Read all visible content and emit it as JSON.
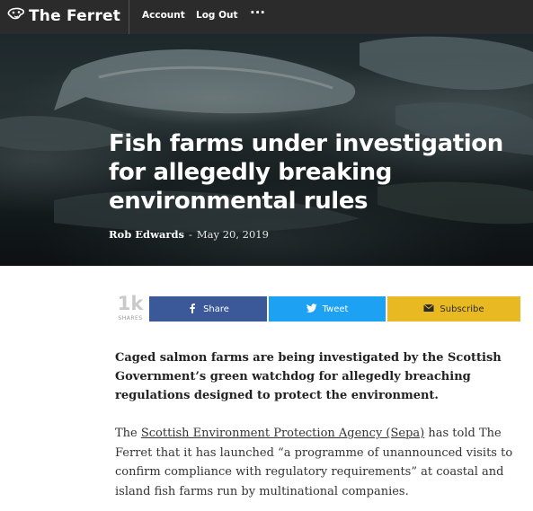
{
  "nav": {
    "logo_text": "The Ferret",
    "account_label": "Account",
    "logout_label": "Log Out",
    "more_label": "···"
  },
  "hero": {
    "headline": "Fish farms under investigation for allegedly breaking environmental rules",
    "author": "Rob Edwards",
    "separator": "-",
    "date": "May 20, 2019"
  },
  "share": {
    "count": "1k",
    "count_label": "SHARES",
    "share_label": "Share",
    "tweet_label": "Tweet",
    "subscribe_label": "Subscribe"
  },
  "article": {
    "lede": "Caged salmon farms are being investigated by the Scottish Government’s green watchdog for allegedly breaching regulations designed to protect the environment.",
    "para_prefix": "The ",
    "para_link": "Scottish Environment Protection Agency (Sepa)",
    "para_rest": " has told The Ferret that it has launched “a programme of unannounced visits to confirm compliance with regulatory requirements” at coastal and island fish farms run by multinational companies."
  },
  "colors": {
    "topbar": "#2b2b2b",
    "facebook": "#3b5998",
    "twitter": "#1da1f2",
    "subscribe": "#e8b923"
  },
  "icons": [
    "ferret-logo-icon",
    "facebook-icon",
    "twitter-icon",
    "envelope-icon"
  ]
}
